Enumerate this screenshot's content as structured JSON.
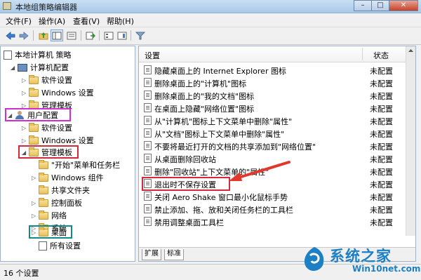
{
  "window": {
    "title": "本地组策略编辑器"
  },
  "window_buttons": {
    "minimize": "–",
    "maximize": "□",
    "close": "✕"
  },
  "menu": [
    "文件(F)",
    "操作(A)",
    "查看(V)",
    "帮助(H)"
  ],
  "toolbar": {
    "icons": [
      "back-icon",
      "forward-icon",
      "up-folder-icon",
      "show-hide-tree-icon",
      "properties-icon",
      "help-icon",
      "export-icon",
      "view-icon",
      "filter-icon"
    ]
  },
  "tree": {
    "root": "本地计算机 策略",
    "computer_config": "计算机配置",
    "cc_software": "软件设置",
    "cc_windows": "Windows 设置",
    "cc_admin": "管理模板",
    "user_config": "用户配置",
    "uc_software": "软件设置",
    "uc_windows": "Windows 设置",
    "uc_admin": "管理模板",
    "start_menu": "\"开始\"菜单和任务栏",
    "win_components": "Windows 组件",
    "shared_folders": "共享文件夹",
    "control_panel": "控制面板",
    "network": "网络",
    "system": "系统",
    "desktop": "桌面",
    "all_settings": "所有设置"
  },
  "highlights": {
    "user_config_color": "#d02fd0",
    "admin_templates_color": "#d02a3c",
    "desktop_color": "#138a8a",
    "target_color": "#d02a3c",
    "arrow_color": "#e0382c"
  },
  "list": {
    "col_setting": "设置",
    "col_state": "状态",
    "rows": [
      {
        "name": "隐藏桌面上的 Internet Explorer 图标",
        "state": "未配置"
      },
      {
        "name": "删除桌面上的\"计算机\"图标",
        "state": "未配置"
      },
      {
        "name": "删除桌面上的\"我的文档\"图标",
        "state": "未配置"
      },
      {
        "name": "在桌面上隐藏\"网络位置\"图标",
        "state": "未配置"
      },
      {
        "name": "从\"计算机\"图标上下文菜单中删除\"属性\"",
        "state": "未配置"
      },
      {
        "name": "从\"文档\"图标上下文菜单中删除\"属性\"",
        "state": "未配置"
      },
      {
        "name": "不要将最近打开的文档的共享添加到\"网络位置\"",
        "state": "未配置"
      },
      {
        "name": "从桌面删除回收站",
        "state": "未配置"
      },
      {
        "name": "删除\"回收站\"上下文菜单的\"属性\"",
        "state": "未配置"
      },
      {
        "name": "退出时不保存设置",
        "state": "未配置"
      },
      {
        "name": "关闭 Aero Shake 窗口最小化鼠标手势",
        "state": "未配置"
      },
      {
        "name": "禁止添加、拖、放和关闭任务栏的工具栏",
        "state": "未配置"
      },
      {
        "name": "禁用调整桌面工具栏",
        "state": "未配置"
      }
    ]
  },
  "tabs": [
    "扩展",
    "标准"
  ],
  "status": "16 个设置",
  "watermark": {
    "title": "系统之家",
    "url": "Win10net.com"
  }
}
